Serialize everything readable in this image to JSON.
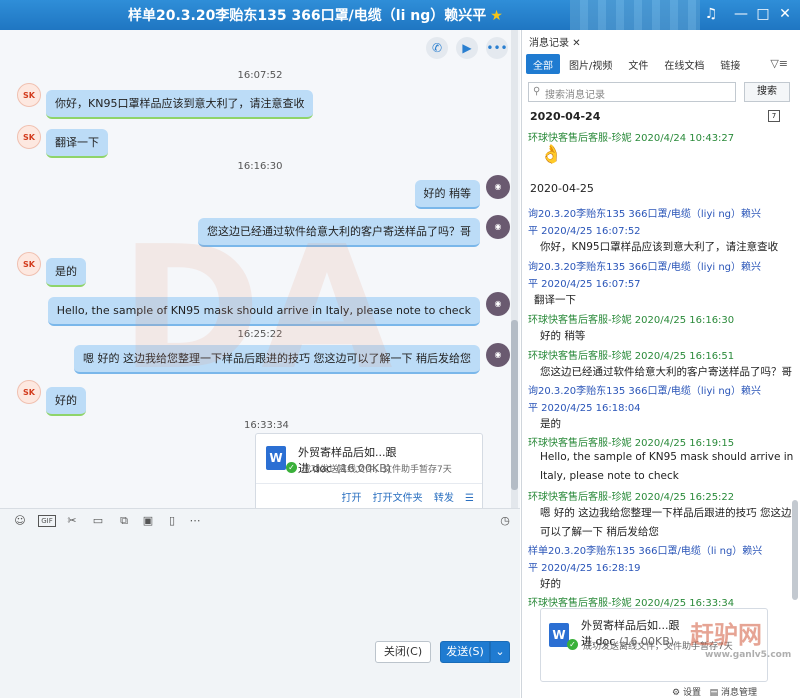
{
  "window": {
    "title": "样单20.3.20李贻东135    366口罩/电缆（li    ng）赖兴平",
    "star": "★"
  },
  "chat": {
    "timestamps": [
      "16:07:52",
      "16:16:30",
      "16:25:22",
      "16:33:34"
    ],
    "avatar_left": "SK",
    "messages": [
      {
        "side": "left",
        "text": "你好，KN95口罩样品应该到意大利了，请注意查收"
      },
      {
        "side": "left",
        "text": "翻译一下"
      },
      {
        "side": "right",
        "text": "好的  稍等"
      },
      {
        "side": "right",
        "text": "您这边已经通过软件给意大利的客户寄送样品了吗？哥"
      },
      {
        "side": "left",
        "text": "是的"
      },
      {
        "side": "right",
        "text": "Hello, the sample of KN95 mask should arrive in Italy, please note to check"
      },
      {
        "side": "right",
        "text": "嗯 好的  这边我给您整理一下样品后跟进的技巧  您这边可以了解一下 稍后发给您"
      },
      {
        "side": "left",
        "text": "好的"
      }
    ],
    "file": {
      "name": "外贸寄样品后如...跟进.doc",
      "size": "(16.00KB)",
      "status": "成功发送离线文件，文件助手暂存7天",
      "actions": [
        "打开",
        "打开文件夹",
        "转发"
      ]
    },
    "buttons": {
      "close": "关闭(C)",
      "send": "发送(S)"
    }
  },
  "history": {
    "title": "消息记录",
    "tabs": [
      "全部",
      "图片/视频",
      "文件",
      "在线文档",
      "链接"
    ],
    "search_placeholder": "搜索消息记录",
    "search_button": "搜索",
    "date1": "2020-04-24",
    "date2": "2020-04-25",
    "entries": [
      {
        "sender": "环球快客售后客服-珍妮 2020/4/24 10:43:27",
        "color": "g"
      },
      {
        "sender": "询20.3.20李贻东135      366口罩/电缆（liyi  ng）赖兴",
        "color": "b"
      },
      {
        "sender": "平 2020/4/25 16:07:52",
        "color": "b"
      },
      {
        "msg": "你好，KN95口罩样品应该到意大利了，请注意查收"
      },
      {
        "sender": "询20.3.20李贻东135      366口罩/电缆（liyi  ng）赖兴",
        "color": "b"
      },
      {
        "sender": "平 2020/4/25 16:07:57",
        "color": "b"
      },
      {
        "msg": "翻译一下"
      },
      {
        "sender": "环球快客售后客服-珍妮 2020/4/25 16:16:30",
        "color": "g"
      },
      {
        "msg": "好的  稍等"
      },
      {
        "sender": "环球快客售后客服-珍妮 2020/4/25 16:16:51",
        "color": "g"
      },
      {
        "msg": "您这边已经通过软件给意大利的客户寄送样品了吗？哥"
      },
      {
        "sender": "询20.3.20李贻东135      366口罩/电缆（liyi  ng）赖兴",
        "color": "b"
      },
      {
        "sender": "平 2020/4/25 16:18:04",
        "color": "b"
      },
      {
        "msg": "是的"
      },
      {
        "sender": "环球快客售后客服-珍妮 2020/4/25 16:19:15",
        "color": "g"
      },
      {
        "msg": "Hello, the sample of KN95 mask should arrive in"
      },
      {
        "msg": "Italy, please note to check"
      },
      {
        "sender": "环球快客售后客服-珍妮 2020/4/25 16:25:22",
        "color": "g"
      },
      {
        "msg": "嗯 好的  这边我给您整理一下样品后跟进的技巧  您这边"
      },
      {
        "msg": "可以了解一下 稍后发给您"
      },
      {
        "sender": "样单20.3.20李贻东135      366口罩/电缆（li    ng）赖兴",
        "color": "b"
      },
      {
        "sender": "平 2020/4/25 16:28:19",
        "color": "b"
      },
      {
        "msg": "好的"
      },
      {
        "sender": "环球快客售后客服-珍妮 2020/4/25 16:33:34",
        "color": "g"
      }
    ],
    "file_name": "外贸寄样品后如...跟进.doc",
    "file_size": "(16.00KB)",
    "file_status": "成功发送离线文件，文件助手暂存7天",
    "bottom": {
      "settings": "设置",
      "manage": "消息管理"
    }
  },
  "watermark": {
    "site": "赶驴网",
    "url": "www.ganlv5.com"
  }
}
